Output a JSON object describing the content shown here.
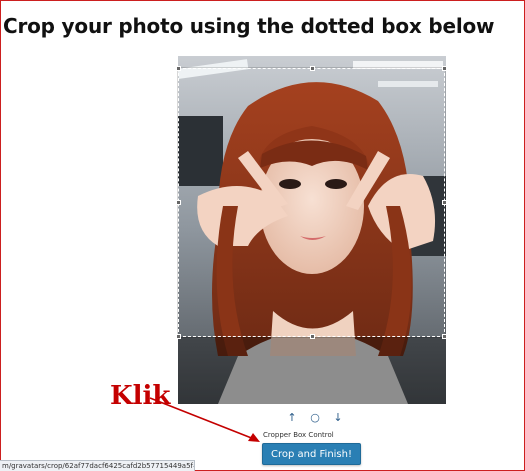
{
  "heading": "Crop your photo using the dotted box below",
  "cropper": {
    "controls": {
      "up": "↑",
      "reset": "○",
      "down": "↓"
    },
    "control_label": "Cropper Box Control",
    "finish_button": "Crop and Finish!"
  },
  "annotation": {
    "text": "Klik",
    "color": "#c40000"
  },
  "status_bar": {
    "url": "m/gravatars/crop/62af77dacf6425cafd2b57715449a5f#"
  },
  "colors": {
    "button": "#2a7fb4",
    "frame_border": "#cc1f1f"
  }
}
